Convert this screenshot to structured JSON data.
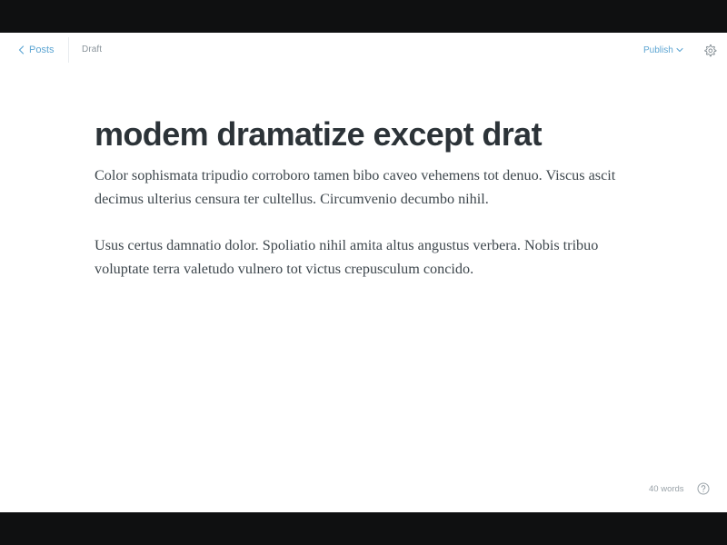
{
  "header": {
    "back_label": "Posts",
    "back_icon": "chevron-left-icon",
    "status": "Draft",
    "publish_label": "Publish",
    "publish_icon": "chevron-down-icon",
    "settings_icon": "gear-icon"
  },
  "post": {
    "title": "modem dramatize except drat",
    "paragraphs": [
      "Color sophismata tripudio corroboro tamen bibo caveo vehemens tot denuo. Viscus ascit decimus ulterius censura ter cultellus. Circumvenio decumbo nihil.",
      "Usus certus damnatio dolor. Spoliatio nihil amita altus angustus verbera. Nobis tribuo voluptate terra valetudo vulnero tot victus crepusculum concido."
    ]
  },
  "footer": {
    "word_count": "40 words",
    "help_icon": "question-mark-icon"
  },
  "colors": {
    "accent": "#5ea6d3",
    "title_text": "#2c3338",
    "body_text": "#3e474d",
    "muted_text": "#8a949b",
    "frame": "#0f1011"
  }
}
